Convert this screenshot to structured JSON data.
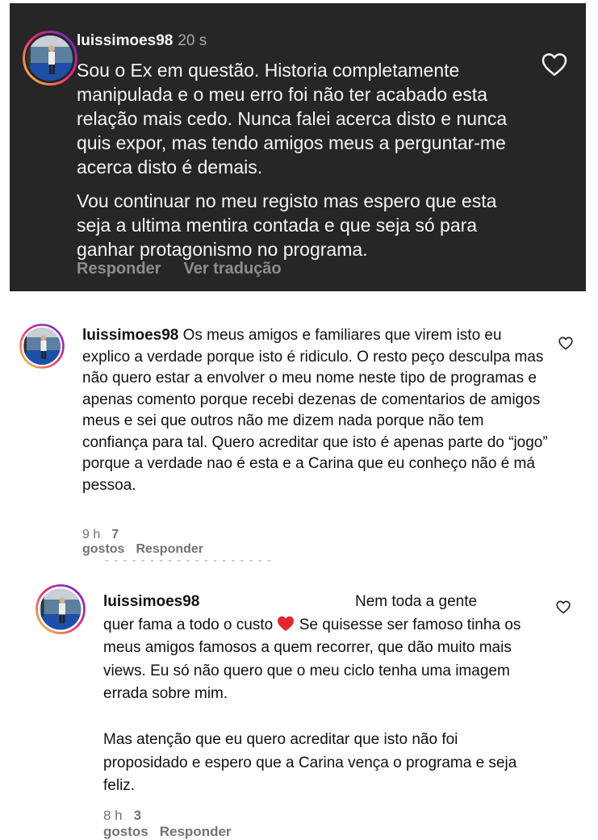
{
  "comment1": {
    "username": "luissimoes98",
    "time": "20 s",
    "paragraph1": "Sou o Ex em questão. Historia completamente manipulada e o meu erro foi não ter acabado esta relação mais cedo. Nunca falei acerca disto e nunca quis expor, mas tendo amigos meus a perguntar-me acerca disto é demais.",
    "paragraph2": "Vou continuar no meu registo mas espero que esta seja a ultima mentira contada e que seja só para ganhar protagonismo no programa.",
    "reply_label": "Responder",
    "translate_label": "Ver tradução",
    "like_icon": "heart-outline-icon"
  },
  "comment2": {
    "username": "luissimoes98",
    "text": "Os meus amigos e familiares que virem isto eu explico a verdade porque isto é ridiculo. O resto peço desculpa mas não quero estar a envolver o meu nome neste tipo de programas e apenas comento porque recebi dezenas de comentarios de amigos meus e sei que outros não me dizem nada porque não tem confiança para tal. Quero acreditar que isto é apenas parte do “jogo” porque a verdade nao é esta e a Carina que eu conheço não é má pessoa.",
    "time": "9 h",
    "likes": "7 gostos",
    "reply_label": "Responder",
    "like_icon": "heart-outline-icon"
  },
  "comment3": {
    "username": "luissimoes98",
    "line1": "Nem toda a gente",
    "line2_before_emoji": "quer fama a todo o custo",
    "emoji": "❤️",
    "line2_after_emoji": "Se quisesse ser famoso tinha os meus amigos famosos a quem recorrer, que dão muito mais views. Eu só não quero que o meu ciclo tenha uma imagem errada sobre mim.",
    "paragraph2": "Mas atenção que eu quero acreditar que isto não foi proposidado e espero que a Carina vença o programa e seja feliz.",
    "time": "8 h",
    "likes": "3 gostos",
    "reply_label": "Responder",
    "like_icon": "heart-outline-icon"
  },
  "colors": {
    "dark_bg": "#262626",
    "story_ring_start": "#f9ce34",
    "story_ring_mid": "#ee2a7b",
    "story_ring_end": "#6228d7"
  }
}
